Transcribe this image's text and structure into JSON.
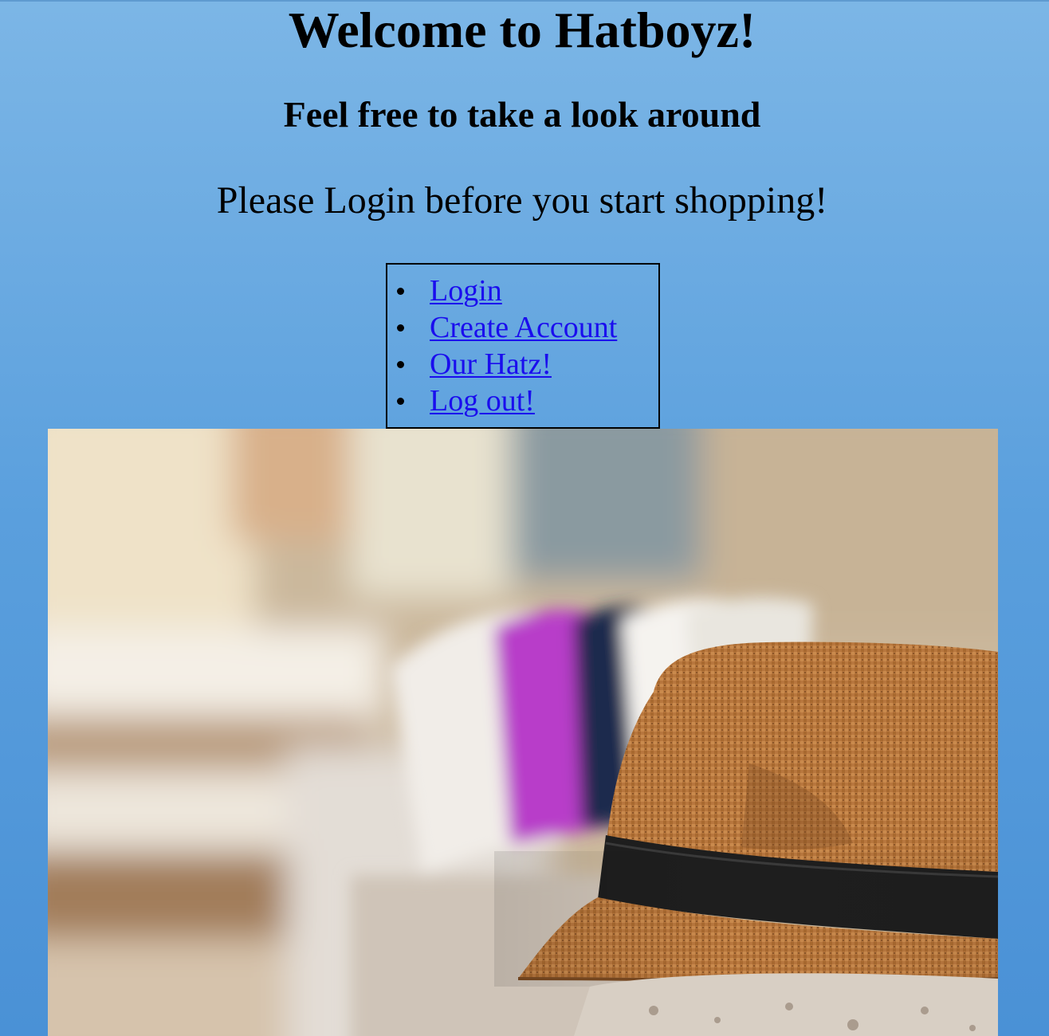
{
  "header": {
    "title": "Welcome to Hatboyz!",
    "subtitle": "Feel free to take a look around",
    "prompt": "Please Login before you start shopping!"
  },
  "nav": {
    "items": [
      {
        "label": "Login"
      },
      {
        "label": "Create Account"
      },
      {
        "label": "Our Hatz!"
      },
      {
        "label": "Log out!"
      }
    ]
  },
  "hero": {
    "icon": "fedora-hat-photo"
  },
  "colors": {
    "background_top": "#7cb6e6",
    "background_bottom": "#4a91d6",
    "link": "#1a0dee",
    "hat_straw": "#b8773e",
    "hat_band": "#1e1e1e"
  }
}
